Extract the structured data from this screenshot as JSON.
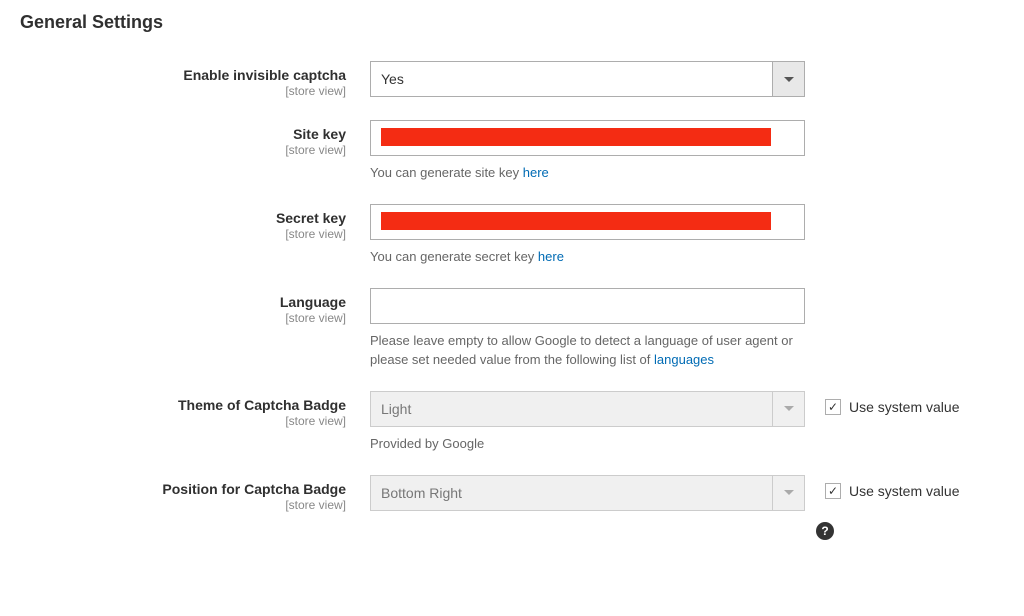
{
  "section_title": "General Settings",
  "scope_label": "[store view]",
  "use_system_value_label": "Use system value",
  "fields": {
    "enable_captcha": {
      "label": "Enable invisible captcha",
      "value": "Yes"
    },
    "site_key": {
      "label": "Site key",
      "helper_prefix": "You can generate site key ",
      "helper_link": "here"
    },
    "secret_key": {
      "label": "Secret key",
      "helper_prefix": "You can generate secret key ",
      "helper_link": "here"
    },
    "language": {
      "label": "Language",
      "value": "",
      "helper_prefix": "Please leave empty to allow Google to detect a language of user agent or please set needed value from the following list of ",
      "helper_link": "languages"
    },
    "theme": {
      "label": "Theme of Captcha Badge",
      "value": "Light",
      "helper": "Provided by Google",
      "use_system": true
    },
    "position": {
      "label": "Position for Captcha Badge",
      "value": "Bottom Right",
      "use_system": true
    }
  }
}
